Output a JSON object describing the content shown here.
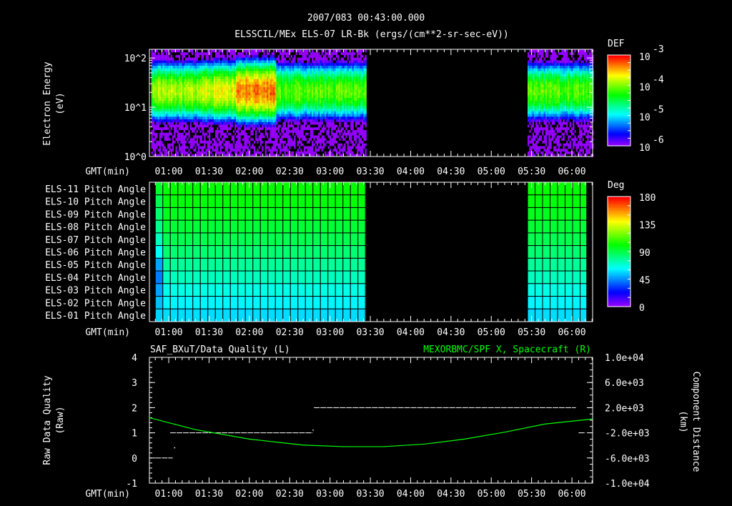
{
  "header": {
    "title": "2007/083 00:43:00.000",
    "subtitle": "ELSSCIL/MEx ELS-07 LR-Bk  (ergs/(cm**2-sr-sec-eV))"
  },
  "chart_data": [
    {
      "type": "heatmap",
      "name": "energy-spectrogram",
      "ylabel": "Electron Energy (eV)",
      "xlabel": "GMT(min)",
      "x_range_min": [
        45.6,
        375.4
      ],
      "y_range": [
        1,
        150
      ],
      "y_scale": "log",
      "y_ticks": [
        "10^0",
        "10^1",
        "10^2"
      ],
      "x_ticks": [
        "01:00",
        "01:30",
        "02:00",
        "02:30",
        "03:00",
        "03:30",
        "04:00",
        "04:30",
        "05:00",
        "05:30",
        "06:00"
      ],
      "colorbar": {
        "label": "DEF",
        "scale": "log",
        "range": [
          1e-06,
          0.001
        ],
        "ticks": [
          "10^-3",
          "10^-4",
          "10^-5",
          "10^-6"
        ]
      },
      "data_intervals_min": [
        [
          47,
          207
        ],
        [
          327,
          375
        ]
      ],
      "peak_energy_eV": 20,
      "segments": [
        {
          "start_min": 47,
          "end_min": 85,
          "peak_log_def": -3.9
        },
        {
          "start_min": 85,
          "end_min": 110,
          "peak_log_def": -3.7
        },
        {
          "start_min": 110,
          "end_min": 140,
          "peak_log_def": -3.3
        },
        {
          "start_min": 140,
          "end_min": 207,
          "peak_log_def": -4.1
        },
        {
          "start_min": 327,
          "end_min": 375,
          "peak_log_def": -4.1
        }
      ]
    },
    {
      "type": "heatmap",
      "name": "pitch-angle-grid",
      "xlabel": "GMT(min)",
      "rows": [
        "ELS-11 Pitch Angle",
        "ELS-10 Pitch Angle",
        "ELS-09 Pitch Angle",
        "ELS-08 Pitch Angle",
        "ELS-07 Pitch Angle",
        "ELS-06 Pitch Angle",
        "ELS-05 Pitch Angle",
        "ELS-04 Pitch Angle",
        "ELS-03 Pitch Angle",
        "ELS-02 Pitch Angle",
        "ELS-01 Pitch Angle"
      ],
      "row_values_deg": [
        102,
        100,
        97,
        93,
        89,
        84,
        78,
        72,
        66,
        61,
        57
      ],
      "first_column_values_deg": [
        95,
        90,
        85,
        80,
        72,
        62,
        48,
        42,
        48,
        52,
        55
      ],
      "x_ticks": [
        "01:00",
        "01:30",
        "02:00",
        "02:30",
        "03:00",
        "03:30",
        "04:00",
        "04:30",
        "05:00",
        "05:30",
        "06:00"
      ],
      "data_intervals_min": [
        [
          50,
          207
        ],
        [
          327,
          371
        ]
      ],
      "colorbar": {
        "label": "Deg",
        "range": [
          0,
          180
        ],
        "ticks": [
          "180",
          "135",
          "90",
          "45",
          "0"
        ]
      }
    },
    {
      "type": "line",
      "name": "quality-and-distance",
      "title_left": "SAF_BXuT/Data Quality (L)",
      "title_right": "MEXORBMC/SPF X, Spacecraft (R)",
      "ylabel_left": "Raw Data Quality (Raw)",
      "ylabel_right": "Component Distance (km)",
      "xlabel": "GMT(min)",
      "ylim_left": [
        -1,
        4
      ],
      "yticks_left": [
        "4",
        "3",
        "2",
        "1",
        "0",
        "-1"
      ],
      "ylim_right": [
        -10000,
        10000
      ],
      "yticks_right": [
        "1.0e+04",
        "6.0e+03",
        "2.0e+03",
        "-2.0e+03",
        "-6.0e+03",
        "-1.0e+04"
      ],
      "x_ticks": [
        "01:00",
        "01:30",
        "02:00",
        "02:30",
        "03:00",
        "03:30",
        "04:00",
        "04:30",
        "05:00",
        "05:30",
        "06:00"
      ],
      "quality_segments": [
        {
          "start_min": 50,
          "end_min": 63,
          "value": 0
        },
        {
          "start_min": 61,
          "end_min": 167,
          "value": 1
        },
        {
          "start_min": 168,
          "end_min": 363,
          "value": 2
        },
        {
          "start_min": 365,
          "end_min": 370,
          "value": 1
        }
      ],
      "quality_points": [
        {
          "x_min": 64,
          "value": 0.4
        },
        {
          "x_min": 167,
          "value": 1.1
        }
      ],
      "distance_series": {
        "color": "#00ff00",
        "x_min": [
          45.6,
          80,
          120,
          160,
          190,
          220,
          250,
          280,
          310,
          340,
          375.4
        ],
        "values_km": [
          400,
          -1500,
          -3000,
          -3950,
          -4200,
          -4200,
          -3800,
          -3000,
          -1900,
          -600,
          200
        ]
      }
    }
  ],
  "colors": {
    "accent_green": "#00ff00",
    "background": "#000000",
    "foreground": "#ffffff"
  }
}
